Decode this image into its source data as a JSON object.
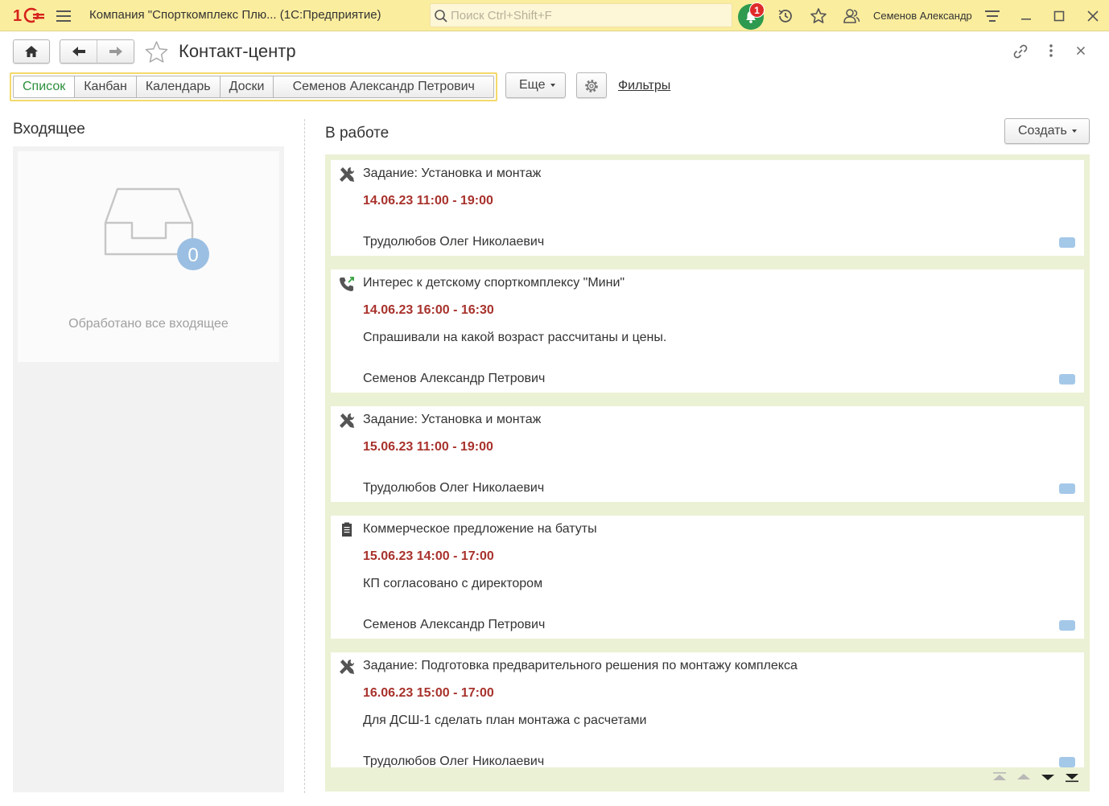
{
  "titlebar": {
    "app_title": "Компания \"Спорткомплекс Плю...  (1С:Предприятие)",
    "search_placeholder": "Поиск Ctrl+Shift+F",
    "notification_count": "1",
    "user_name": "Семенов Александр",
    "icons": [
      "logo-1c",
      "menu-icon",
      "search-icon",
      "bell-icon",
      "history-icon",
      "star-icon",
      "users-icon",
      "settings-lines-icon",
      "minimize-icon",
      "maximize-icon",
      "close-icon"
    ]
  },
  "form": {
    "title": "Контакт-центр"
  },
  "view_tabs": [
    {
      "label": "Список",
      "active": true
    },
    {
      "label": "Канбан",
      "active": false
    },
    {
      "label": "Календарь",
      "active": false
    },
    {
      "label": "Доски",
      "active": false
    },
    {
      "label": "Семенов Александр Петрович",
      "active": false
    }
  ],
  "toolbar": {
    "more_label": "Еще",
    "filters_label": "Фильтры",
    "create_label": "Создать"
  },
  "incoming": {
    "title": "Входящее",
    "count": "0",
    "empty_text": "Обработано все входящее"
  },
  "in_work": {
    "title": "В работе",
    "cards": [
      {
        "icon": "tools-icon",
        "title": "Задание: Установка и монтаж",
        "date": "14.06.23 11:00 - 19:00",
        "description": "",
        "user": "Трудолюбов Олег Николаевич"
      },
      {
        "icon": "phone-incoming-icon",
        "title": "Интерес к детскому спорткомплексу \"Мини\"",
        "date": "14.06.23 16:00 - 16:30",
        "description": "Спрашивали на какой возраст рассчитаны и цены.",
        "user": "Семенов Александр Петрович"
      },
      {
        "icon": "tools-icon",
        "title": "Задание: Установка и монтаж",
        "date": "15.06.23 11:00 - 19:00",
        "description": "",
        "user": "Трудолюбов Олег Николаевич"
      },
      {
        "icon": "document-icon",
        "title": "Коммерческое предложение на батуты",
        "date": "15.06.23 14:00 - 17:00",
        "description": "КП согласовано с директором",
        "user": "Семенов Александр Петрович"
      },
      {
        "icon": "tools-icon",
        "title": "Задание: Подготовка предварительного решения по монтажу комплекса",
        "date": "16.06.23 15:00 - 17:00",
        "description": "Для ДСШ-1 сделать план монтажа с расчетами",
        "user": "Трудолюбов Олег Николаевич"
      }
    ]
  },
  "colors": {
    "titlebar_bg": "#fbed9e",
    "active_tab_text": "#2a8f3c",
    "date_text": "#a8322c",
    "work_panel_bg": "#ebf1d4",
    "tag_color": "#a4c8e8"
  }
}
